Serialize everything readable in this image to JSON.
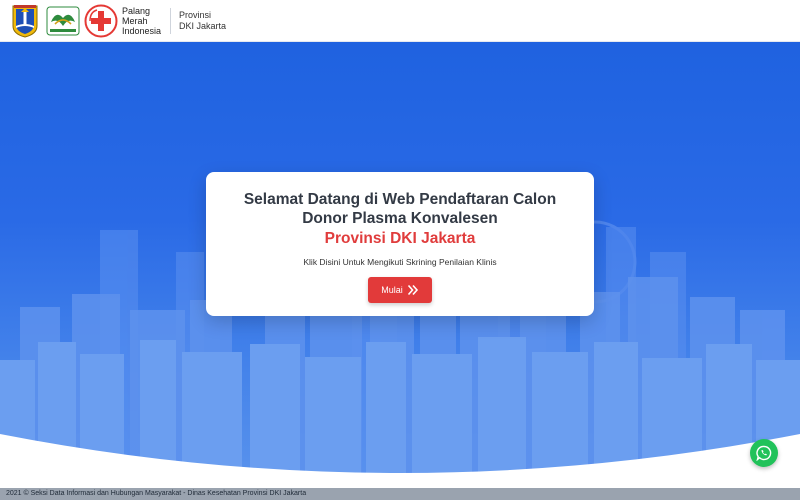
{
  "header": {
    "pmi_lines": [
      "Palang",
      "Merah",
      "Indonesia"
    ],
    "province_lines": [
      "Provinsi",
      "DKI Jakarta"
    ]
  },
  "card": {
    "title_lines": [
      "Selamat Datang di Web Pendaftaran Calon",
      "Donor Plasma Konvalesen"
    ],
    "province": "Provinsi DKI Jakarta",
    "subtitle": "Klik Disini Untuk Mengikuti Skrining Penilaian Klinis",
    "button_label": "Mulai"
  },
  "footer": {
    "text": "2021 © Seksi Data Informasi dan Hubungan Masyarakat - Dinas Kesehatan Provinsi DKI Jakarta"
  },
  "icons": {
    "whatsapp": "whatsapp-icon",
    "chevrons": "double-chevron-right-icon"
  },
  "colors": {
    "primary_blue": "#1f62e0",
    "accent_red": "#e03c3c",
    "whatsapp_green": "#21c25a"
  }
}
